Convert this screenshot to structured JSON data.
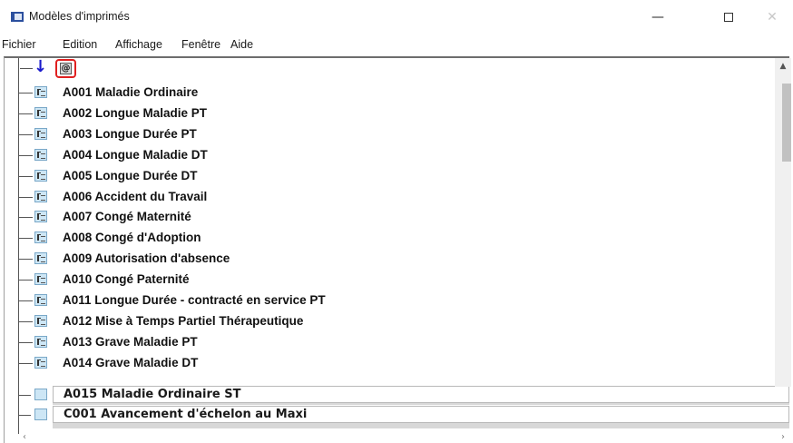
{
  "window": {
    "title": "Modèles d'imprimés",
    "minimize_glyph": "—",
    "close_glyph": "✕"
  },
  "menu": {
    "items": [
      "Fichier",
      "Edition",
      "Affichage",
      "Fenêtre",
      "Aide"
    ]
  },
  "tree": {
    "root_icons": [
      "arrow-down-icon",
      "at-sign-icon"
    ],
    "items": [
      "A001 Maladie Ordinaire",
      "A002 Longue Maladie PT",
      "A003 Longue Durée PT",
      "A004 Longue Maladie DT",
      "A005 Longue Durée DT",
      "A006 Accident du Travail",
      "A007 Congé Maternité",
      "A008 Congé d'Adoption",
      "A009 Autorisation d'absence",
      "A010 Congé Paternité",
      "A011 Longue Durée - contracté en service PT",
      "A012 Mise à Temps Partiel Thérapeutique",
      "A013 Grave Maladie PT",
      "A014 Grave Maladie DT"
    ],
    "overlay_items": [
      "A015 Maladie Ordinaire ST",
      "C001 Avancement d'échelon au Maxi"
    ],
    "highlight_color": "#e02020"
  }
}
